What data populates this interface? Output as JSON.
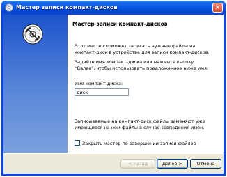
{
  "window": {
    "title": "Мастер записи компакт-дисков",
    "close_label": "×"
  },
  "content": {
    "heading": "Мастер записи компакт-дисков",
    "intro_line1": "Этот мастер поможет записать нужные файлы на",
    "intro_line2": "компакт-диск в устройстве для записи компакт-дисков.",
    "instruction_line1": "Задайте имя компакт-диска или нажмите кнопку",
    "instruction_line2": "\"Далее\", чтобы использовать предложенное ниже имя.",
    "name_label": "Имя компакт-диска:",
    "name_value": "диск",
    "warning_line1": "Записываемые на компакт-диск файлы заменяют уже",
    "warning_line2": "имеющиеся на нем файлы в случае совпадения имен.",
    "checkbox_label": "Закрыть мастер по завершении записи файлов",
    "checkbox_checked": false
  },
  "buttons": {
    "back": "< Назад",
    "next": "Далее >",
    "cancel": "Отмена"
  },
  "icons": {
    "title_icon": "cd-write-icon",
    "wizard_icon": "cd-disc-icon"
  },
  "colors": {
    "titlebar": "#0a5ae6",
    "sidebar": "#5a86d8",
    "dialog_face": "#ece9d8"
  }
}
